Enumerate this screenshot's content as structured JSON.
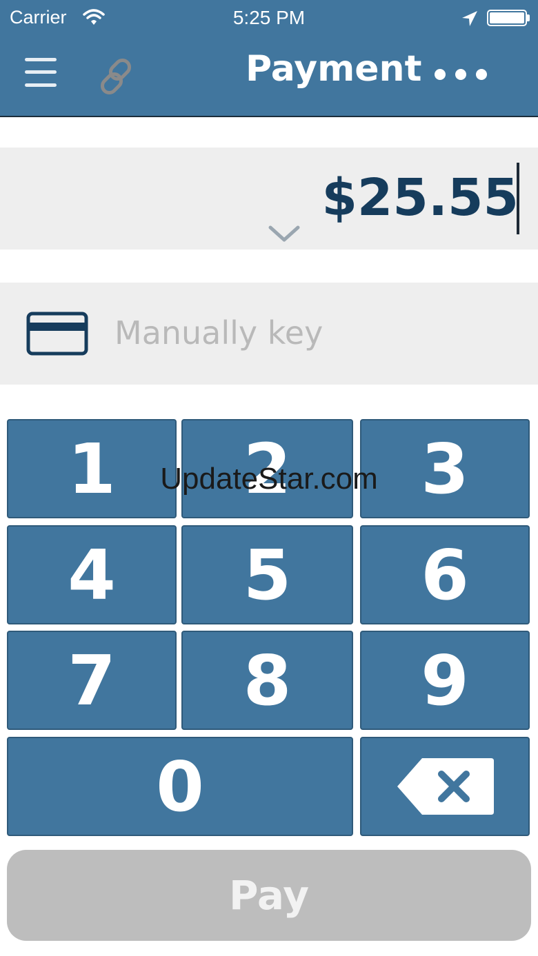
{
  "status_bar": {
    "carrier": "Carrier",
    "time": "5:25 PM",
    "wifi_icon": "wifi-icon",
    "location_icon": "location-arrow-icon",
    "battery_icon": "battery-full-icon"
  },
  "header": {
    "title": "Payment",
    "menu_icon": "hamburger-menu-icon",
    "link_icon": "link-icon",
    "more_icon": "more-dots-icon",
    "color": "#41769e"
  },
  "amount": {
    "value": "$25.55",
    "expand_icon": "chevron-down-icon",
    "color": "#163c5c"
  },
  "card_entry": {
    "placeholder": "Manually key",
    "icon": "credit-card-icon"
  },
  "keypad": {
    "keys": [
      "1",
      "2",
      "3",
      "4",
      "5",
      "6",
      "7",
      "8",
      "9",
      "0"
    ],
    "backspace_icon": "backspace-icon",
    "key_color": "#41769e"
  },
  "watermark": "UpdateStar.com",
  "pay_button": {
    "label": "Pay",
    "color": "#bdbdbd"
  }
}
